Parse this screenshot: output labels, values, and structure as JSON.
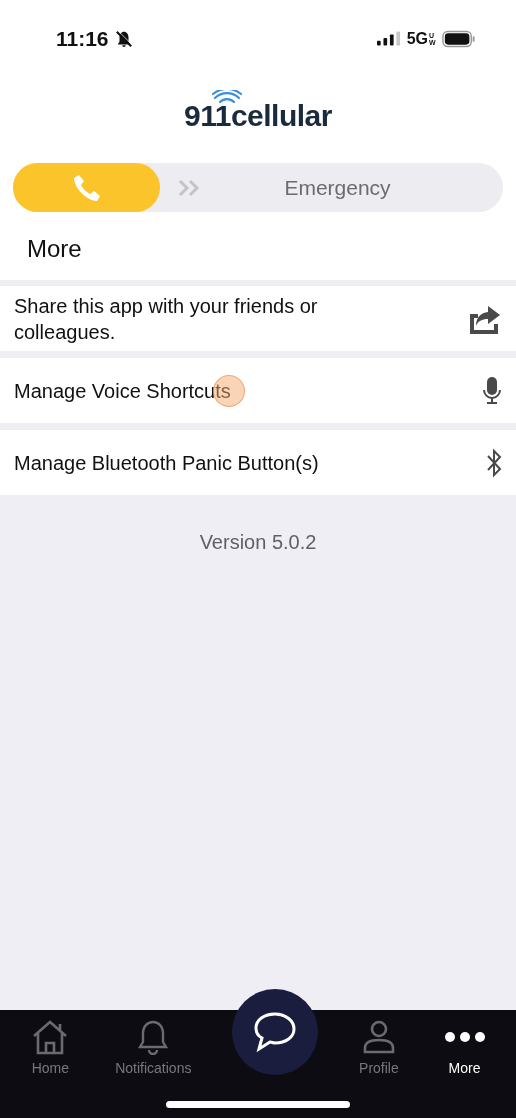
{
  "status_bar": {
    "time": "11:16",
    "network": "5G",
    "network_sub": "UW",
    "silent": true
  },
  "logo": {
    "text": "911cellular"
  },
  "emergency_slider": {
    "label": "Emergency",
    "level": 0.3
  },
  "page_title": "More",
  "menu_items": [
    {
      "label": "Share this app with your friends or colleagues."
    },
    {
      "label": "Manage Voice Shortcuts",
      "touched": true
    },
    {
      "label": "Manage Bluetooth Panic Button(s)"
    }
  ],
  "version": "Version 5.0.2",
  "tab_bar": [
    {
      "kind": "tab",
      "label": "Home",
      "selected": false
    },
    {
      "kind": "tab",
      "label": "Notifications",
      "selected": false
    },
    {
      "kind": "fab"
    },
    {
      "kind": "tab",
      "label": "Profile",
      "selected": false
    },
    {
      "kind": "tab",
      "label": "More",
      "selected": true
    }
  ]
}
